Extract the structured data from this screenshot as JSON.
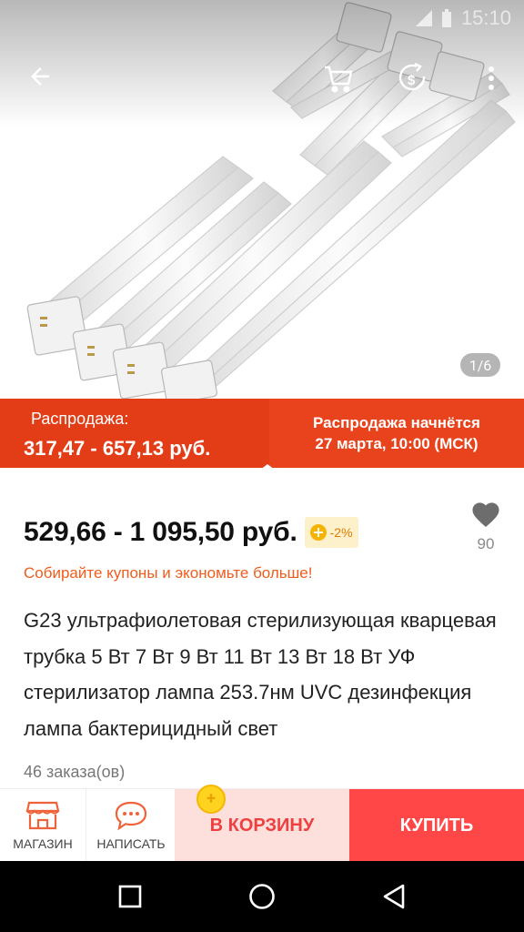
{
  "status_bar": {
    "time": "15:10"
  },
  "gallery": {
    "current": 1,
    "total": 6,
    "indicator": "1/6"
  },
  "sale_banner": {
    "label": "Распродажа:",
    "price": "317,47 - 657,13 руб.",
    "start_line1": "Распродажа начнётся",
    "start_line2": "27 марта, 10:00 (МСК)"
  },
  "product": {
    "price": "529,66 - 1 095,50 руб.",
    "discount": "-2%",
    "wishlist_count": "90",
    "coupon_text": "Собирайте купоны и экономьте больше!",
    "title": "G23 ультрафиолетовая стерилизующая кварцевая трубка 5 Вт 7 Вт 9 Вт 11 Вт 13 Вт 18 Вт УФ стерилизатор лампа 253.7нм UVC дезинфекция лампа бактерицидный свет",
    "orders": "46 заказа(ов)"
  },
  "action_bar": {
    "store_label": "МАГАЗИН",
    "message_label": "НАПИСАТЬ",
    "cart_label": "В КОРЗИНУ",
    "buy_label": "КУПИТЬ"
  },
  "colors": {
    "sale_banner": "#e8431d",
    "buy_button": "#ff4747",
    "cart_button_bg": "#fde0dc",
    "accent_orange": "#f05c1d"
  }
}
